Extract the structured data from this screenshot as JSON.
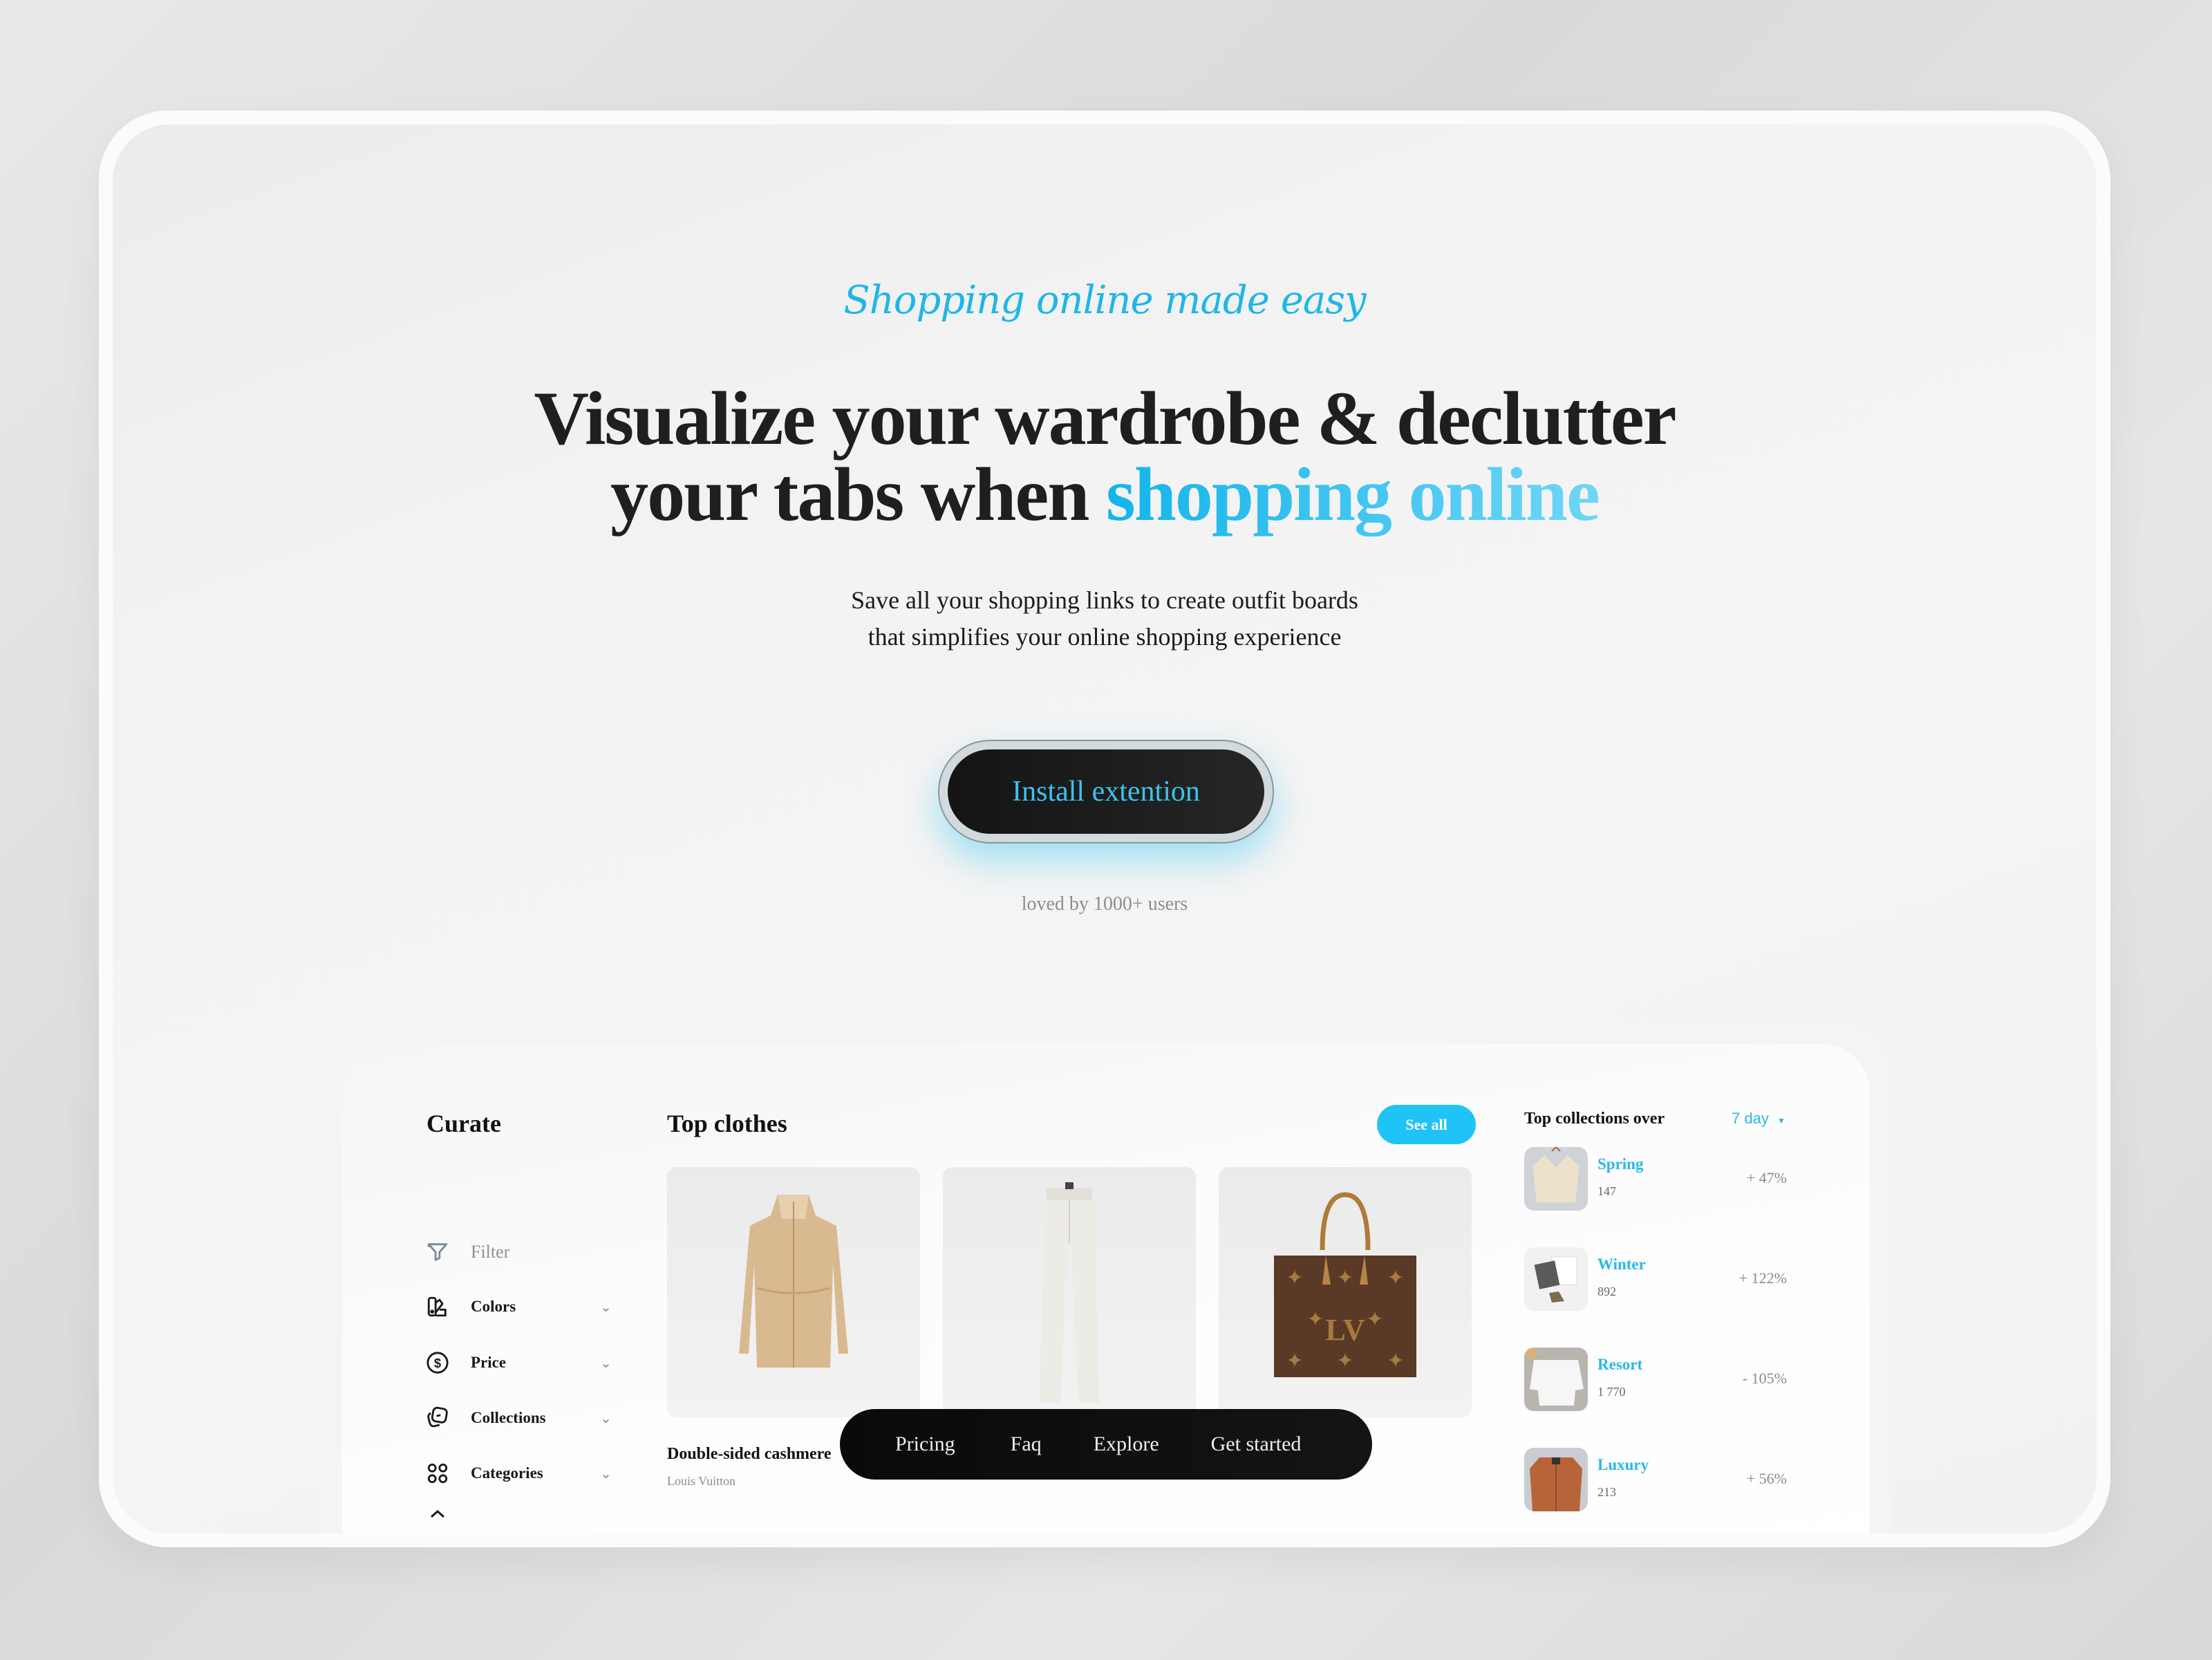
{
  "hero": {
    "tagline": "Shopping online made easy",
    "headline_line1": "Visualize your wardrobe & declutter",
    "headline_line2_prefix": "your tabs when ",
    "headline_line2_highlight": "shopping online",
    "subtitle_line1": "Save all your shopping links to create outfit boards",
    "subtitle_line2": "that simplifies your online shopping experience",
    "cta_label": "Install extention",
    "social_proof": "loved by 1000+ users"
  },
  "colors": {
    "accent": "#20c3f5",
    "headline": "#1f1f1f",
    "cta_bg": "#141414"
  },
  "dashboard": {
    "brand": "Curate",
    "sidebar": {
      "filter_label": "Filter",
      "items": [
        {
          "label": "Colors",
          "icon": "color-swatch-icon"
        },
        {
          "label": "Price",
          "icon": "dollar-circle-icon"
        },
        {
          "label": "Collections",
          "icon": "collections-icon"
        },
        {
          "label": "Categories",
          "icon": "grid-icon"
        }
      ]
    },
    "top_clothes": {
      "title": "Top clothes",
      "see_all_label": "See all",
      "products": [
        {
          "name": "Double-sided cashmere",
          "brand": "Louis Vuitton",
          "image": "beige-hooded-coat"
        },
        {
          "image": "white-trousers"
        },
        {
          "image": "monogram-tote-bag"
        }
      ]
    },
    "collections": {
      "title": "Top collections over",
      "range": "7 day",
      "items": [
        {
          "name": "Spring",
          "count": "147",
          "change": "+ 47%"
        },
        {
          "name": "Winter",
          "count": "892",
          "change": "+ 122%"
        },
        {
          "name": "Resort",
          "count": "1 770",
          "change": "- 105%"
        },
        {
          "name": "Luxury",
          "count": "213",
          "change": "+ 56%"
        }
      ]
    }
  },
  "nav": {
    "links": [
      "Pricing",
      "Faq",
      "Explore",
      "Get started"
    ]
  }
}
